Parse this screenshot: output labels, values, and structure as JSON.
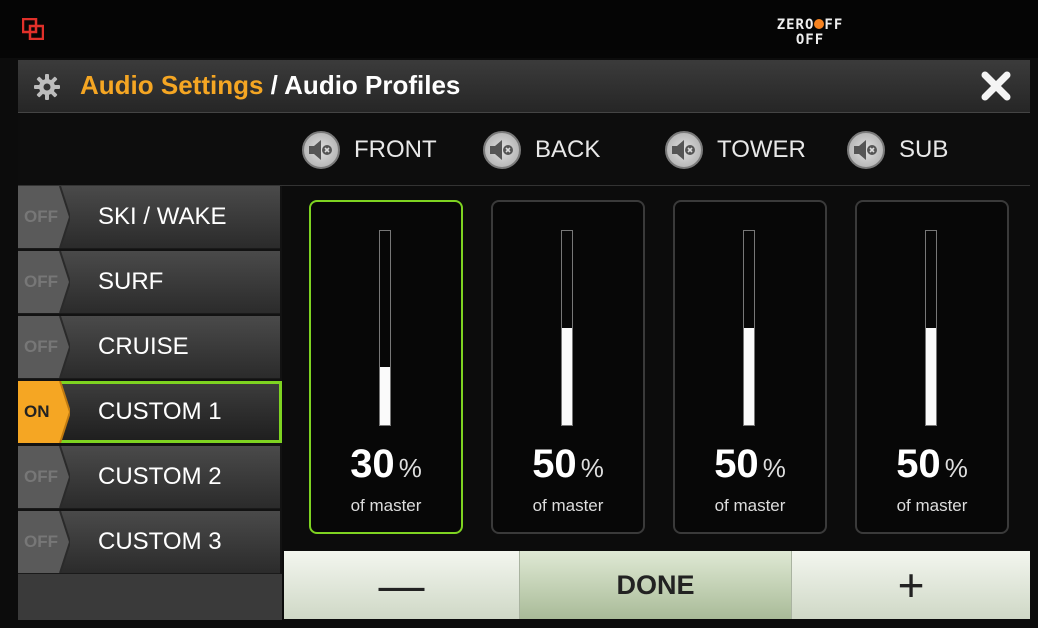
{
  "status": {
    "logo_text": "ZERO",
    "logo_suffix": "FF",
    "state": "OFF"
  },
  "header": {
    "title_section": "Audio Settings",
    "title_page": "/ Audio Profiles"
  },
  "channels": [
    {
      "label": "FRONT",
      "percent": "30",
      "level": 0.3
    },
    {
      "label": "BACK",
      "percent": "50",
      "level": 0.5
    },
    {
      "label": "TOWER",
      "percent": "50",
      "level": 0.5
    },
    {
      "label": "SUB",
      "percent": "50",
      "level": 0.5
    }
  ],
  "percent_unit": "%",
  "of_master": "of master",
  "profiles": [
    {
      "name": "SKI / WAKE",
      "state": "OFF"
    },
    {
      "name": "SURF",
      "state": "OFF"
    },
    {
      "name": "CRUISE",
      "state": "OFF"
    },
    {
      "name": "CUSTOM 1",
      "state": "ON"
    },
    {
      "name": "CUSTOM 2",
      "state": "OFF"
    },
    {
      "name": "CUSTOM 3",
      "state": "OFF"
    }
  ],
  "buttons": {
    "minus": "—",
    "done": "DONE",
    "plus": "+"
  },
  "colors": {
    "accent": "#f5a623",
    "selected_border": "#7ed321",
    "on_tab": "#f5a623",
    "off_tab": "#5a5a5a"
  }
}
